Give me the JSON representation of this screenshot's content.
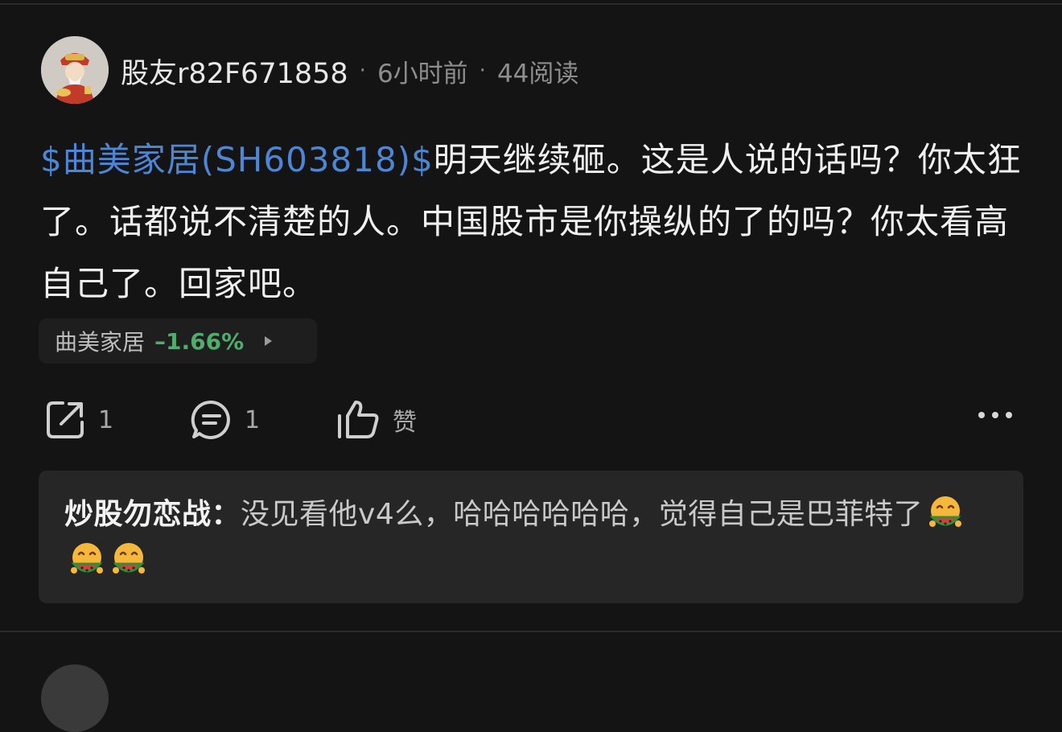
{
  "post": {
    "username": "股友r82F671858",
    "time": "6小时前",
    "reads": "44阅读",
    "separator": "·",
    "stock_tag": "$曲美家居(SH603818)$",
    "body": "明天继续砸。这是人说的话吗？你太狂了。话都说不清楚的人。中国股市是你操纵的了的吗？你太看高自己了。回家吧。"
  },
  "stock_chip": {
    "name": "曲美家居",
    "change": "–1.66%",
    "change_color": "#4fae6b"
  },
  "actions": {
    "share_count": "1",
    "comment_count": "1",
    "like_label": "赞"
  },
  "comment": {
    "author": "炒股勿恋战：",
    "text": "没见看他v4么，哈哈哈哈哈哈，觉得自己是巴菲特了",
    "emoji_icon": "watermelon-eating-emoji"
  },
  "colors": {
    "background": "#141414",
    "link": "#4e86d6",
    "negative": "#4fae6b"
  }
}
